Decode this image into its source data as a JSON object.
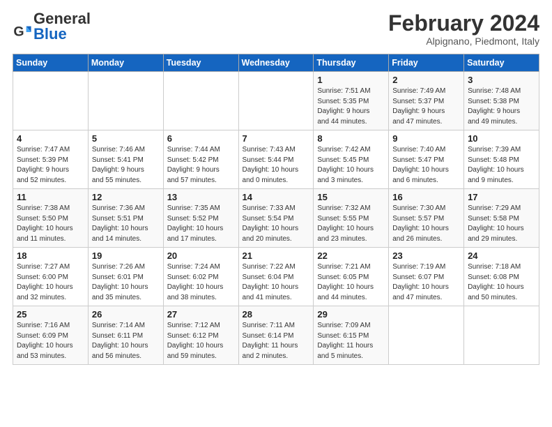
{
  "header": {
    "logo_general": "General",
    "logo_blue": "Blue",
    "month_title": "February 2024",
    "subtitle": "Alpignano, Piedmont, Italy"
  },
  "weekdays": [
    "Sunday",
    "Monday",
    "Tuesday",
    "Wednesday",
    "Thursday",
    "Friday",
    "Saturday"
  ],
  "weeks": [
    [
      {
        "day": "",
        "info": ""
      },
      {
        "day": "",
        "info": ""
      },
      {
        "day": "",
        "info": ""
      },
      {
        "day": "",
        "info": ""
      },
      {
        "day": "1",
        "info": "Sunrise: 7:51 AM\nSunset: 5:35 PM\nDaylight: 9 hours\nand 44 minutes."
      },
      {
        "day": "2",
        "info": "Sunrise: 7:49 AM\nSunset: 5:37 PM\nDaylight: 9 hours\nand 47 minutes."
      },
      {
        "day": "3",
        "info": "Sunrise: 7:48 AM\nSunset: 5:38 PM\nDaylight: 9 hours\nand 49 minutes."
      }
    ],
    [
      {
        "day": "4",
        "info": "Sunrise: 7:47 AM\nSunset: 5:39 PM\nDaylight: 9 hours\nand 52 minutes."
      },
      {
        "day": "5",
        "info": "Sunrise: 7:46 AM\nSunset: 5:41 PM\nDaylight: 9 hours\nand 55 minutes."
      },
      {
        "day": "6",
        "info": "Sunrise: 7:44 AM\nSunset: 5:42 PM\nDaylight: 9 hours\nand 57 minutes."
      },
      {
        "day": "7",
        "info": "Sunrise: 7:43 AM\nSunset: 5:44 PM\nDaylight: 10 hours\nand 0 minutes."
      },
      {
        "day": "8",
        "info": "Sunrise: 7:42 AM\nSunset: 5:45 PM\nDaylight: 10 hours\nand 3 minutes."
      },
      {
        "day": "9",
        "info": "Sunrise: 7:40 AM\nSunset: 5:47 PM\nDaylight: 10 hours\nand 6 minutes."
      },
      {
        "day": "10",
        "info": "Sunrise: 7:39 AM\nSunset: 5:48 PM\nDaylight: 10 hours\nand 9 minutes."
      }
    ],
    [
      {
        "day": "11",
        "info": "Sunrise: 7:38 AM\nSunset: 5:50 PM\nDaylight: 10 hours\nand 11 minutes."
      },
      {
        "day": "12",
        "info": "Sunrise: 7:36 AM\nSunset: 5:51 PM\nDaylight: 10 hours\nand 14 minutes."
      },
      {
        "day": "13",
        "info": "Sunrise: 7:35 AM\nSunset: 5:52 PM\nDaylight: 10 hours\nand 17 minutes."
      },
      {
        "day": "14",
        "info": "Sunrise: 7:33 AM\nSunset: 5:54 PM\nDaylight: 10 hours\nand 20 minutes."
      },
      {
        "day": "15",
        "info": "Sunrise: 7:32 AM\nSunset: 5:55 PM\nDaylight: 10 hours\nand 23 minutes."
      },
      {
        "day": "16",
        "info": "Sunrise: 7:30 AM\nSunset: 5:57 PM\nDaylight: 10 hours\nand 26 minutes."
      },
      {
        "day": "17",
        "info": "Sunrise: 7:29 AM\nSunset: 5:58 PM\nDaylight: 10 hours\nand 29 minutes."
      }
    ],
    [
      {
        "day": "18",
        "info": "Sunrise: 7:27 AM\nSunset: 6:00 PM\nDaylight: 10 hours\nand 32 minutes."
      },
      {
        "day": "19",
        "info": "Sunrise: 7:26 AM\nSunset: 6:01 PM\nDaylight: 10 hours\nand 35 minutes."
      },
      {
        "day": "20",
        "info": "Sunrise: 7:24 AM\nSunset: 6:02 PM\nDaylight: 10 hours\nand 38 minutes."
      },
      {
        "day": "21",
        "info": "Sunrise: 7:22 AM\nSunset: 6:04 PM\nDaylight: 10 hours\nand 41 minutes."
      },
      {
        "day": "22",
        "info": "Sunrise: 7:21 AM\nSunset: 6:05 PM\nDaylight: 10 hours\nand 44 minutes."
      },
      {
        "day": "23",
        "info": "Sunrise: 7:19 AM\nSunset: 6:07 PM\nDaylight: 10 hours\nand 47 minutes."
      },
      {
        "day": "24",
        "info": "Sunrise: 7:18 AM\nSunset: 6:08 PM\nDaylight: 10 hours\nand 50 minutes."
      }
    ],
    [
      {
        "day": "25",
        "info": "Sunrise: 7:16 AM\nSunset: 6:09 PM\nDaylight: 10 hours\nand 53 minutes."
      },
      {
        "day": "26",
        "info": "Sunrise: 7:14 AM\nSunset: 6:11 PM\nDaylight: 10 hours\nand 56 minutes."
      },
      {
        "day": "27",
        "info": "Sunrise: 7:12 AM\nSunset: 6:12 PM\nDaylight: 10 hours\nand 59 minutes."
      },
      {
        "day": "28",
        "info": "Sunrise: 7:11 AM\nSunset: 6:14 PM\nDaylight: 11 hours\nand 2 minutes."
      },
      {
        "day": "29",
        "info": "Sunrise: 7:09 AM\nSunset: 6:15 PM\nDaylight: 11 hours\nand 5 minutes."
      },
      {
        "day": "",
        "info": ""
      },
      {
        "day": "",
        "info": ""
      }
    ]
  ]
}
